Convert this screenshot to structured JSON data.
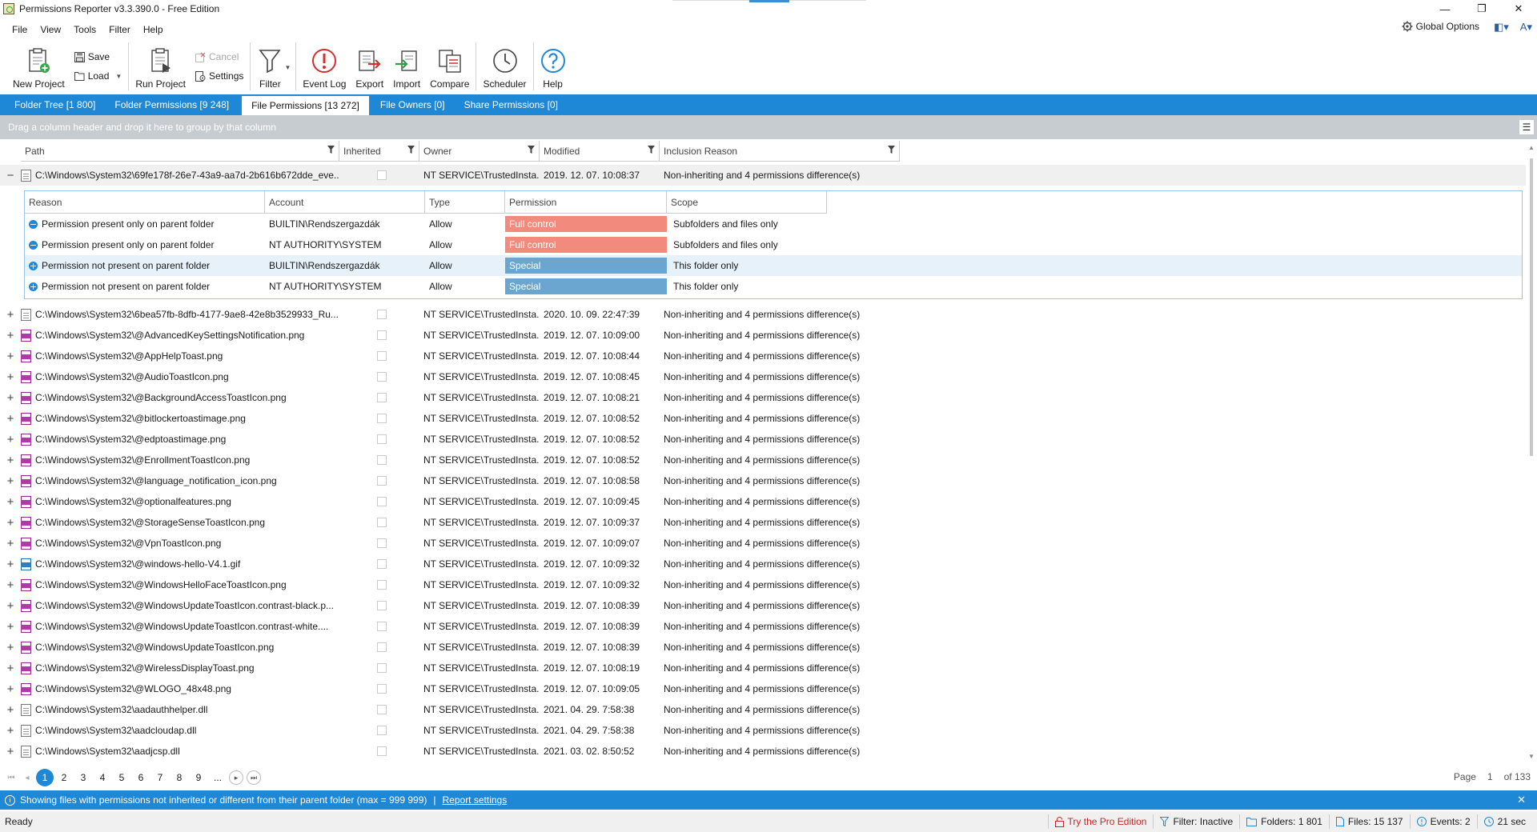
{
  "window": {
    "title": "Permissions Reporter v3.3.390.0 - Free Edition"
  },
  "menu": [
    "File",
    "View",
    "Tools",
    "Filter",
    "Help"
  ],
  "global_options": "Global Options",
  "ribbon": {
    "new_project": "New Project",
    "save": "Save",
    "load": "Load",
    "run_project": "Run Project",
    "cancel": "Cancel",
    "settings": "Settings",
    "filter": "Filter",
    "event_log": "Event Log",
    "export": "Export",
    "import": "Import",
    "compare": "Compare",
    "scheduler": "Scheduler",
    "help": "Help"
  },
  "tabs": [
    {
      "label": "Folder Tree [1 800]",
      "active": false
    },
    {
      "label": "Folder Permissions [9 248]",
      "active": false
    },
    {
      "label": "File Permissions [13 272]",
      "active": true
    },
    {
      "label": "File Owners [0]",
      "active": false
    },
    {
      "label": "Share Permissions [0]",
      "active": false
    }
  ],
  "group_panel_text": "Drag a column header and drop it here to group by that column",
  "grid_columns": [
    "Path",
    "Inherited",
    "Owner",
    "Modified",
    "Inclusion Reason"
  ],
  "expanded_row": {
    "path": "C:\\Windows\\System32\\69fe178f-26e7-43a9-aa7d-2b616b672dde_eve...",
    "owner": "NT SERVICE\\TrustedInsta...",
    "modified": "2019. 12. 07. 10:08:37",
    "reason": "Non-inheriting and 4 permissions difference(s)"
  },
  "detail_columns": [
    "Reason",
    "Account",
    "Type",
    "Permission",
    "Scope"
  ],
  "detail_rows": [
    {
      "reason": "Permission present only on parent folder",
      "icon": "minus-circle-icon",
      "account": "BUILTIN\\Rendszergazdák",
      "type": "Allow",
      "permission": "Full control",
      "perm_color": "#f28b7d",
      "scope": "Subfolders and files only"
    },
    {
      "reason": "Permission present only on parent folder",
      "icon": "minus-circle-icon",
      "account": "NT AUTHORITY\\SYSTEM",
      "type": "Allow",
      "permission": "Full control",
      "perm_color": "#f28b7d",
      "scope": "Subfolders and files only"
    },
    {
      "reason": "Permission not present on parent folder",
      "icon": "plus-circle-icon",
      "account": "BUILTIN\\Rendszergazdák",
      "type": "Allow",
      "permission": "Special",
      "perm_color": "#6ba6d0",
      "scope": "This folder only"
    },
    {
      "reason": "Permission not present on parent folder",
      "icon": "plus-circle-icon",
      "account": "NT AUTHORITY\\SYSTEM",
      "type": "Allow",
      "permission": "Special",
      "perm_color": "#6ba6d0",
      "scope": "This folder only"
    }
  ],
  "rows": [
    {
      "path": "C:\\Windows\\System32\\6bea57fb-8dfb-4177-9ae8-42e8b3529933_Ru...",
      "icon": "file",
      "owner": "NT SERVICE\\TrustedInsta...",
      "modified": "2020. 10. 09. 22:47:39",
      "reason": "Non-inheriting and 4 permissions difference(s)"
    },
    {
      "path": "C:\\Windows\\System32\\@AdvancedKeySettingsNotification.png",
      "icon": "png",
      "owner": "NT SERVICE\\TrustedInsta...",
      "modified": "2019. 12. 07. 10:09:00",
      "reason": "Non-inheriting and 4 permissions difference(s)"
    },
    {
      "path": "C:\\Windows\\System32\\@AppHelpToast.png",
      "icon": "png",
      "owner": "NT SERVICE\\TrustedInsta...",
      "modified": "2019. 12. 07. 10:08:44",
      "reason": "Non-inheriting and 4 permissions difference(s)"
    },
    {
      "path": "C:\\Windows\\System32\\@AudioToastIcon.png",
      "icon": "png",
      "owner": "NT SERVICE\\TrustedInsta...",
      "modified": "2019. 12. 07. 10:08:45",
      "reason": "Non-inheriting and 4 permissions difference(s)"
    },
    {
      "path": "C:\\Windows\\System32\\@BackgroundAccessToastIcon.png",
      "icon": "png",
      "owner": "NT SERVICE\\TrustedInsta...",
      "modified": "2019. 12. 07. 10:08:21",
      "reason": "Non-inheriting and 4 permissions difference(s)"
    },
    {
      "path": "C:\\Windows\\System32\\@bitlockertoastimage.png",
      "icon": "png",
      "owner": "NT SERVICE\\TrustedInsta...",
      "modified": "2019. 12. 07. 10:08:52",
      "reason": "Non-inheriting and 4 permissions difference(s)"
    },
    {
      "path": "C:\\Windows\\System32\\@edptoastimage.png",
      "icon": "png",
      "owner": "NT SERVICE\\TrustedInsta...",
      "modified": "2019. 12. 07. 10:08:52",
      "reason": "Non-inheriting and 4 permissions difference(s)"
    },
    {
      "path": "C:\\Windows\\System32\\@EnrollmentToastIcon.png",
      "icon": "png",
      "owner": "NT SERVICE\\TrustedInsta...",
      "modified": "2019. 12. 07. 10:08:52",
      "reason": "Non-inheriting and 4 permissions difference(s)"
    },
    {
      "path": "C:\\Windows\\System32\\@language_notification_icon.png",
      "icon": "png",
      "owner": "NT SERVICE\\TrustedInsta...",
      "modified": "2019. 12. 07. 10:08:58",
      "reason": "Non-inheriting and 4 permissions difference(s)"
    },
    {
      "path": "C:\\Windows\\System32\\@optionalfeatures.png",
      "icon": "png",
      "owner": "NT SERVICE\\TrustedInsta...",
      "modified": "2019. 12. 07. 10:09:45",
      "reason": "Non-inheriting and 4 permissions difference(s)"
    },
    {
      "path": "C:\\Windows\\System32\\@StorageSenseToastIcon.png",
      "icon": "png",
      "owner": "NT SERVICE\\TrustedInsta...",
      "modified": "2019. 12. 07. 10:09:37",
      "reason": "Non-inheriting and 4 permissions difference(s)"
    },
    {
      "path": "C:\\Windows\\System32\\@VpnToastIcon.png",
      "icon": "png",
      "owner": "NT SERVICE\\TrustedInsta...",
      "modified": "2019. 12. 07. 10:09:07",
      "reason": "Non-inheriting and 4 permissions difference(s)"
    },
    {
      "path": "C:\\Windows\\System32\\@windows-hello-V4.1.gif",
      "icon": "gif",
      "owner": "NT SERVICE\\TrustedInsta...",
      "modified": "2019. 12. 07. 10:09:32",
      "reason": "Non-inheriting and 4 permissions difference(s)"
    },
    {
      "path": "C:\\Windows\\System32\\@WindowsHelloFaceToastIcon.png",
      "icon": "png",
      "owner": "NT SERVICE\\TrustedInsta...",
      "modified": "2019. 12. 07. 10:09:32",
      "reason": "Non-inheriting and 4 permissions difference(s)"
    },
    {
      "path": "C:\\Windows\\System32\\@WindowsUpdateToastIcon.contrast-black.p...",
      "icon": "png",
      "owner": "NT SERVICE\\TrustedInsta...",
      "modified": "2019. 12. 07. 10:08:39",
      "reason": "Non-inheriting and 4 permissions difference(s)"
    },
    {
      "path": "C:\\Windows\\System32\\@WindowsUpdateToastIcon.contrast-white....",
      "icon": "png",
      "owner": "NT SERVICE\\TrustedInsta...",
      "modified": "2019. 12. 07. 10:08:39",
      "reason": "Non-inheriting and 4 permissions difference(s)"
    },
    {
      "path": "C:\\Windows\\System32\\@WindowsUpdateToastIcon.png",
      "icon": "png",
      "owner": "NT SERVICE\\TrustedInsta...",
      "modified": "2019. 12. 07. 10:08:39",
      "reason": "Non-inheriting and 4 permissions difference(s)"
    },
    {
      "path": "C:\\Windows\\System32\\@WirelessDisplayToast.png",
      "icon": "png",
      "owner": "NT SERVICE\\TrustedInsta...",
      "modified": "2019. 12. 07. 10:08:19",
      "reason": "Non-inheriting and 4 permissions difference(s)"
    },
    {
      "path": "C:\\Windows\\System32\\@WLOGO_48x48.png",
      "icon": "png",
      "owner": "NT SERVICE\\TrustedInsta...",
      "modified": "2019. 12. 07. 10:09:05",
      "reason": "Non-inheriting and 4 permissions difference(s)"
    },
    {
      "path": "C:\\Windows\\System32\\aadauthhelper.dll",
      "icon": "file",
      "owner": "NT SERVICE\\TrustedInsta...",
      "modified": "2021. 04. 29. 7:58:38",
      "reason": "Non-inheriting and 4 permissions difference(s)"
    },
    {
      "path": "C:\\Windows\\System32\\aadcloudap.dll",
      "icon": "file",
      "owner": "NT SERVICE\\TrustedInsta...",
      "modified": "2021. 04. 29. 7:58:38",
      "reason": "Non-inheriting and 4 permissions difference(s)"
    },
    {
      "path": "C:\\Windows\\System32\\aadjcsp.dll",
      "icon": "file",
      "owner": "NT SERVICE\\TrustedInsta...",
      "modified": "2021. 03. 02. 8:50:52",
      "reason": "Non-inheriting and 4 permissions difference(s)"
    }
  ],
  "pager": {
    "pages": [
      "1",
      "2",
      "3",
      "4",
      "5",
      "6",
      "7",
      "8",
      "9",
      "..."
    ],
    "current_page": "1",
    "page_label": "Page",
    "page_value": "1",
    "of_label": "of 133"
  },
  "info": {
    "text": "Showing files with permissions not inherited or different from their parent folder (max = 999 999)",
    "link": "Report settings"
  },
  "status": {
    "ready": "Ready",
    "pro": "Try the Pro Edition",
    "filter": "Filter: Inactive",
    "folders": "Folders: 1 801",
    "files": "Files: 15 137",
    "events": "Events: 2",
    "time": "21 sec"
  }
}
